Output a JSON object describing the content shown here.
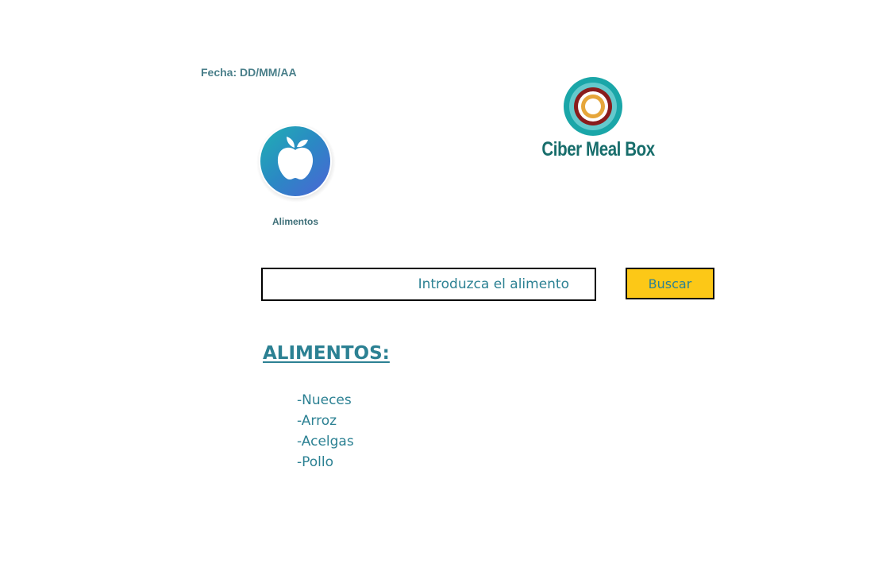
{
  "header": {
    "date_label": "Fecha: DD/MM/AA"
  },
  "category": {
    "icon": "apple-icon",
    "label": "Alimentos"
  },
  "brand": {
    "name": "Ciber Meal Box",
    "logo_icon": "concentric-rings-logo",
    "colors": [
      "#1aa6a8",
      "#8a1c1c",
      "#e6a63a"
    ]
  },
  "search": {
    "placeholder": "Introduzca el alimento",
    "value": "",
    "button_label": "Buscar",
    "button_color": "#fcc817"
  },
  "foods": {
    "title": "ALIMENTOS:",
    "items": [
      "-Nueces",
      "-Arroz",
      "-Acelgas",
      "-Pollo"
    ]
  },
  "colors": {
    "accent": "#2c8193",
    "brand_text": "#176d6b"
  }
}
